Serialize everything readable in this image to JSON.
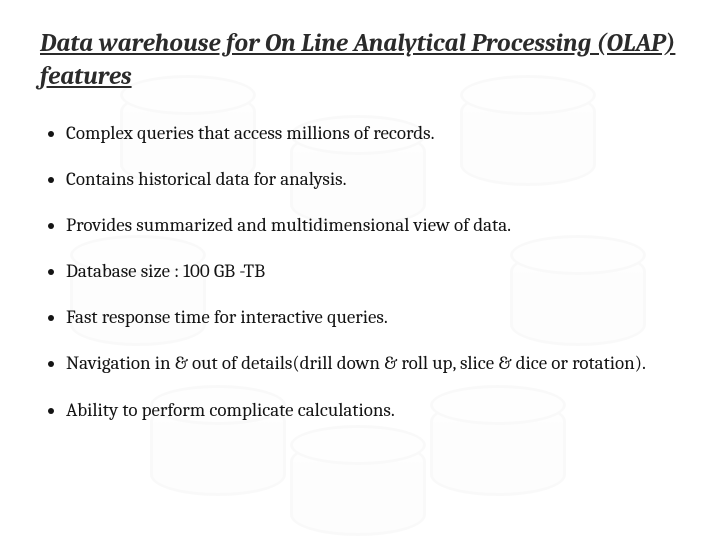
{
  "title": "Data warehouse for On Line Analytical Processing (OLAP) features",
  "bullets": [
    "Complex queries that access millions of records.",
    "Contains historical data for analysis.",
    "Provides summarized and multidimensional view of data.",
    "Database size : 100 GB -TB",
    "Fast response time for interactive queries.",
    "Navigation in & out of details(drill down & roll up, slice & dice or rotation).",
    "Ability to perform complicate calculations."
  ]
}
